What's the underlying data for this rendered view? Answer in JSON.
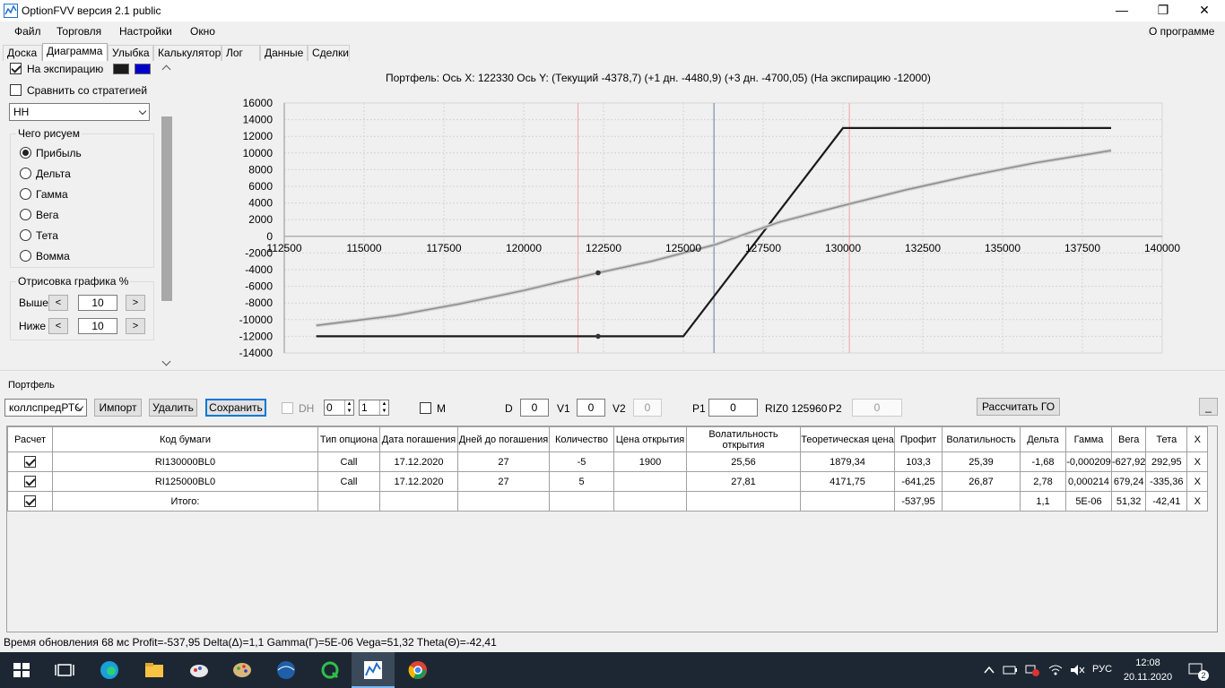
{
  "window": {
    "title": "OptionFVV версия 2.1 public",
    "minimize": "—",
    "maximize": "❐",
    "close": "✕"
  },
  "menu": {
    "items": [
      "Файл",
      "Торговля",
      "Настройки",
      "Окно"
    ],
    "about": "О программе"
  },
  "tabs": [
    "Доска",
    "Диаграмма",
    "Улыбка",
    "Калькулятор",
    "Лог",
    "Данные",
    "Сделки"
  ],
  "left": {
    "expiration_label": "На экспирацию",
    "expiration_checked": true,
    "compare_label": "Сравнить со стратегией",
    "compare_checked": false,
    "swatch_colors": [
      "#1a1a1a",
      "#0000cc"
    ],
    "strategy_value": "НН",
    "what_group": "Чего рисуем",
    "what_options": [
      "Прибыль",
      "Дельта",
      "Гамма",
      "Вега",
      "Тета",
      "Вомма"
    ],
    "what_selected": "Прибыль",
    "draw_group": "Отрисовка графика %",
    "above_label": "Выше",
    "above_value": "10",
    "below_label": "Ниже",
    "below_value": "10",
    "btn_less": "<",
    "btn_more": ">"
  },
  "chart_header": "Портфель: Ось X: 122330 Ось Y:  (Текущий -4378,7)  (+1 дн. -4480,9)  (+3 дн. -4700,05)  (На экспирацию -12000)",
  "chart_data": {
    "type": "line",
    "xlim": [
      112500,
      140000
    ],
    "ylim": [
      -14000,
      16000
    ],
    "x_ticks": [
      112500,
      115000,
      117500,
      120000,
      122500,
      125000,
      127500,
      130000,
      132500,
      135000,
      137500,
      140000
    ],
    "y_ticks": [
      16000,
      14000,
      12000,
      10000,
      8000,
      6000,
      4000,
      2000,
      0,
      -2000,
      -4000,
      -6000,
      -8000,
      -10000,
      -12000,
      -14000
    ],
    "grid": true,
    "markers": {
      "strike_lines": [
        121700,
        130200
      ],
      "current_line": 125960,
      "cursor_x": 122330
    },
    "series": [
      {
        "name": "На экспирацию",
        "color": "#1a1a1a",
        "x": [
          113500,
          125000,
          130000,
          138400
        ],
        "y": [
          -12000,
          -12000,
          13000,
          13000
        ]
      },
      {
        "name": "Текущий",
        "color": "#8a8a8a",
        "x": [
          113500,
          116000,
          118000,
          120000,
          122330,
          124000,
          126000,
          128000,
          130000,
          132000,
          134000,
          136000,
          138400
        ],
        "y": [
          -10700,
          -9500,
          -8100,
          -6500,
          -4378.7,
          -3000,
          -1000,
          1700,
          3700,
          5600,
          7300,
          8800,
          10300
        ]
      }
    ]
  },
  "portfolio": {
    "title": "Портфель",
    "selector": "коллспредРТС",
    "import": "Импорт",
    "delete": "Удалить",
    "save": "Сохранить",
    "dh_label": "DH",
    "spin1": "0",
    "spin2": "1",
    "m_label": "M",
    "d_label": "D",
    "d_value": "0",
    "v1_label": "V1",
    "v1_value": "0",
    "v2_label": "V2",
    "v2_value": "0",
    "p1_label": "P1",
    "p1_value": "0",
    "riz_label": "RIZ0 125960",
    "p2_label": "P2",
    "p2_value": "0",
    "calc_go": "Рассчитать ГО",
    "minimize": "_"
  },
  "grid": {
    "headers": [
      "Расчет",
      "Код бумаги",
      "Тип опциона",
      "Дата погашения",
      "Дней до погашения",
      "Количество",
      "Цена открытия",
      "Волатильность открытия",
      "Теоретическая цена",
      "Профит",
      "Волатильность",
      "Дельта",
      "Гамма",
      "Вега",
      "Тета",
      "X"
    ],
    "rows": [
      [
        "RI130000BL0",
        "Call",
        "17.12.2020",
        "27",
        "-5",
        "1900",
        "25,56",
        "1879,34",
        "103,3",
        "25,39",
        "-1,68",
        "-0,000209",
        "-627,92",
        "292,95",
        "X"
      ],
      [
        "RI125000BL0",
        "Call",
        "17.12.2020",
        "27",
        "5",
        "4300",
        "27,81",
        "4171,75",
        "-641,25",
        "26,87",
        "2,78",
        "0,000214",
        "679,24",
        "-335,36",
        "X"
      ],
      [
        "Итого:",
        "",
        "",
        "",
        "",
        "",
        "",
        "",
        "-537,95",
        "",
        "1,1",
        "5E-06",
        "51,32",
        "-42,41",
        "X"
      ]
    ]
  },
  "status": "Время обновления 68 мс  Profit=-537,95 Delta(Δ)=1,1 Gamma(Γ)=5E-06 Vega=51,32 Theta(Θ)=-42,41",
  "taskbar": {
    "lang": "РУС",
    "time": "12:08",
    "date": "20.11.2020",
    "notif_count": "2"
  }
}
